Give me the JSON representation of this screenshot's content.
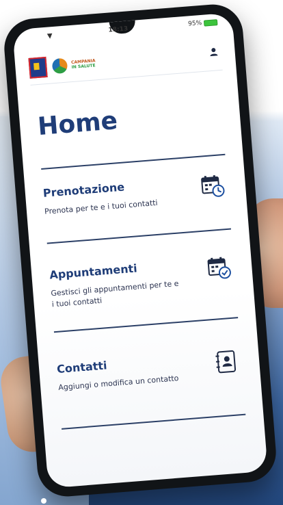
{
  "status": {
    "time": "18:13",
    "battery": "95%"
  },
  "header": {
    "brand_line1": "CAMPANIA",
    "brand_line2": "IN SALUTE"
  },
  "page": {
    "title": "Home"
  },
  "menu": [
    {
      "title": "Prenotazione",
      "description": "Prenota per te e i tuoi contatti",
      "icon": "calendar-clock-icon"
    },
    {
      "title": "Appuntamenti",
      "description": "Gestisci gli appuntamenti per te e i tuoi contatti",
      "icon": "calendar-check-icon"
    },
    {
      "title": "Contatti",
      "description": "Aggiungi o modifica un contatto",
      "icon": "address-book-icon"
    }
  ],
  "colors": {
    "primary": "#1f3d78",
    "accent_blue": "#1c4fa0",
    "battery": "#3cc43c"
  }
}
